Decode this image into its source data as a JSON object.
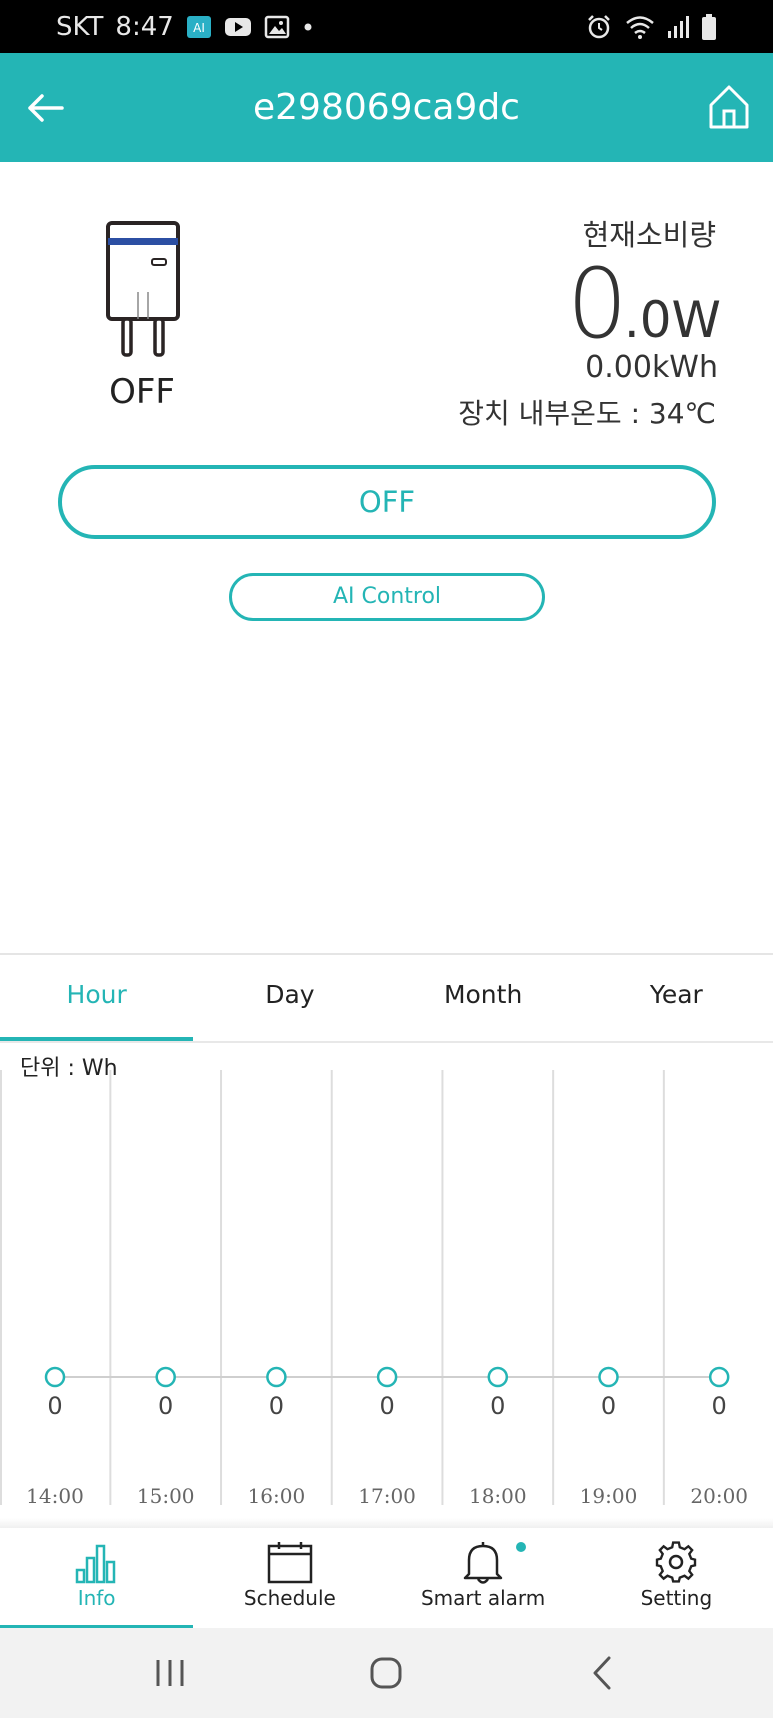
{
  "status_bar": {
    "carrier": "SKT",
    "time": "8:47",
    "left_icons": [
      "ai-app-icon",
      "youtube-icon",
      "gallery-icon",
      "dot-icon"
    ],
    "right_icons": [
      "alarm-icon",
      "wifi-icon",
      "signal-icon",
      "battery-icon"
    ]
  },
  "header": {
    "title": "e298069ca9dc",
    "bg_color": "#24b5b5"
  },
  "device": {
    "state_label": "OFF",
    "consumption_label": "현재소비량",
    "power_int": "0",
    "power_dec": ".0",
    "power_unit": "W",
    "energy": "0.00kWh",
    "temperature": "장치 내부온도 : 34℃"
  },
  "controls": {
    "power_button": "OFF",
    "ai_button": "AI Control"
  },
  "tabs": [
    {
      "label": "Hour",
      "active": true
    },
    {
      "label": "Day",
      "active": false
    },
    {
      "label": "Month",
      "active": false
    },
    {
      "label": "Year",
      "active": false
    }
  ],
  "chart_data": {
    "type": "line",
    "unit_label": "단위 : Wh",
    "categories": [
      "14:00",
      "15:00",
      "16:00",
      "17:00",
      "18:00",
      "19:00",
      "20:00"
    ],
    "values": [
      0,
      0,
      0,
      0,
      0,
      0,
      0
    ],
    "grid": true,
    "color": "#24b5b5"
  },
  "bottom_nav": [
    {
      "label": "Info",
      "icon": "bar-chart-icon",
      "active": true
    },
    {
      "label": "Schedule",
      "icon": "calendar-icon",
      "active": false
    },
    {
      "label": "Smart alarm",
      "icon": "bell-icon",
      "active": false
    },
    {
      "label": "Setting",
      "icon": "gear-icon",
      "active": false
    }
  ],
  "system_nav": [
    "recent-apps-icon",
    "home-icon",
    "back-icon"
  ],
  "accent_color": "#24b5b5"
}
